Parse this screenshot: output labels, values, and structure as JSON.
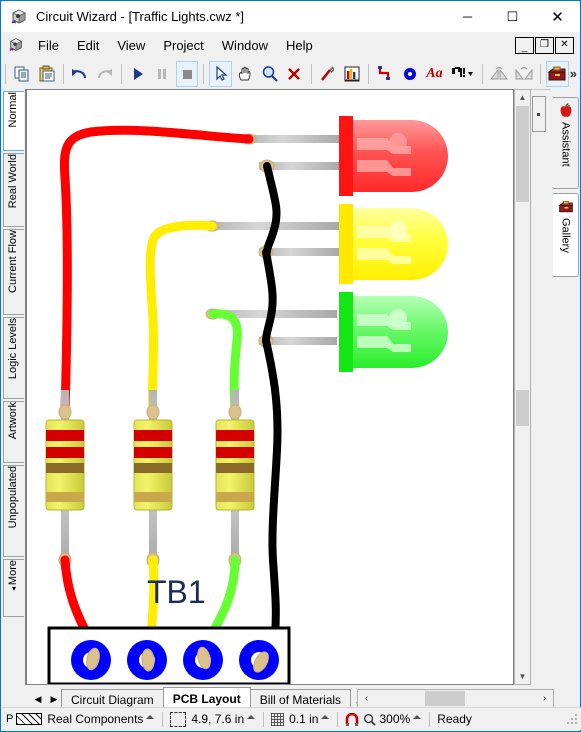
{
  "window": {
    "title": "Circuit Wizard - [Traffic Lights.cwz *]",
    "icon": "circuit-wizard-icon",
    "minimize_label": "─",
    "maximize_label": "☐",
    "close_label": "✕"
  },
  "menu": {
    "icon": "document-icon",
    "items": [
      "File",
      "Edit",
      "View",
      "Project",
      "Window",
      "Help"
    ],
    "mdi_buttons": [
      {
        "name": "mdi-minimize",
        "label": "_"
      },
      {
        "name": "mdi-restore",
        "label": "❐"
      },
      {
        "name": "mdi-close",
        "label": "✕"
      }
    ]
  },
  "toolbar": {
    "overflow_label": "»",
    "buttons": [
      {
        "name": "copy-icon",
        "title": "Copy",
        "selected": false
      },
      {
        "name": "paste-icon",
        "title": "Paste",
        "selected": false
      },
      {
        "name": "undo-icon",
        "title": "Undo",
        "selected": false
      },
      {
        "name": "redo-icon",
        "title": "Redo",
        "selected": false
      },
      {
        "name": "run-icon",
        "title": "Run",
        "selected": false
      },
      {
        "name": "pause-icon",
        "title": "Pause",
        "selected": false
      },
      {
        "name": "stop-icon",
        "title": "Stop",
        "selected": true
      },
      {
        "name": "select-arrow-icon",
        "title": "Select",
        "selected": true
      },
      {
        "name": "pan-hand-icon",
        "title": "Pan",
        "selected": false
      },
      {
        "name": "zoom-magnifier-icon",
        "title": "Zoom",
        "selected": false
      },
      {
        "name": "delete-cross-icon",
        "title": "Delete",
        "selected": false
      },
      {
        "name": "probe-icon",
        "title": "Probe",
        "selected": false
      },
      {
        "name": "chart-icon",
        "title": "Graph",
        "selected": false
      },
      {
        "name": "wire-icon",
        "title": "Wire",
        "selected": false
      },
      {
        "name": "pad-icon",
        "title": "Pad",
        "selected": false
      },
      {
        "name": "text-icon",
        "title": "Text",
        "selected": false
      },
      {
        "name": "component-icon",
        "title": "Component",
        "selected": false
      },
      {
        "name": "flip-left-icon",
        "title": "Flip Left",
        "selected": false
      },
      {
        "name": "flip-right-icon",
        "title": "Flip Right",
        "selected": false
      },
      {
        "name": "gallery-toolbox-icon",
        "title": "Gallery",
        "selected": true
      }
    ]
  },
  "left_tabs": {
    "items": [
      {
        "label": "Normal",
        "selected": true
      },
      {
        "label": "Real World",
        "selected": false
      },
      {
        "label": "Current Flow",
        "selected": false
      },
      {
        "label": "Logic Levels",
        "selected": false
      },
      {
        "label": "Artwork",
        "selected": false
      },
      {
        "label": "Unpopulated",
        "selected": false
      },
      {
        "label": "More",
        "selected": false
      }
    ],
    "more_arrow": "▾"
  },
  "right_tabs": {
    "items": [
      {
        "label": "Assistant",
        "icon": "apple-icon",
        "selected": false
      },
      {
        "label": "Gallery",
        "icon": "toolbox-icon",
        "selected": true
      }
    ]
  },
  "canvas": {
    "label_tb1": "TB1",
    "colors": {
      "led_red": "#ff3030",
      "led_yellow": "#ffff00",
      "led_green": "#33ff33",
      "wire_red": "#ff0000",
      "wire_yellow": "#ffee00",
      "wire_green": "#66ff33",
      "wire_black": "#000000",
      "lead_grey": "#c0c0c0",
      "solder_tan": "#ddc18d",
      "resistor_body": "#e8e84b",
      "terminal_blue": "#0000ff"
    },
    "components": [
      {
        "name": "led-red",
        "color": "#ff3030"
      },
      {
        "name": "led-yellow",
        "color": "#ffff00"
      },
      {
        "name": "led-green",
        "color": "#33ff33"
      },
      {
        "name": "resistor-1",
        "bands": [
          "red",
          "red",
          "brown",
          "gold"
        ]
      },
      {
        "name": "resistor-2",
        "bands": [
          "red",
          "red",
          "brown",
          "gold"
        ]
      },
      {
        "name": "resistor-3",
        "bands": [
          "red",
          "red",
          "brown",
          "gold"
        ]
      },
      {
        "name": "terminal-block-tb1",
        "terminals": 4
      }
    ]
  },
  "doc_tabs": {
    "prev_label": "◀",
    "next_label": "▶",
    "items": [
      {
        "label": "Circuit Diagram",
        "selected": false
      },
      {
        "label": "PCB Layout",
        "selected": true
      },
      {
        "label": "Bill of Materials",
        "selected": false
      }
    ],
    "overflow_label": "‹"
  },
  "hscroll": {
    "left_label": "‹",
    "right_label": "›"
  },
  "vscroll": {
    "up_label": "▲",
    "down_label": "▼"
  },
  "statusbar": {
    "mode_prefix": "P",
    "mode_label": "Real Components",
    "cursor_label": "4.9, 7.6 in",
    "grid_label": "0.1 in",
    "zoom_label": "300%",
    "ready_label": "Ready",
    "spin_label": "▴"
  }
}
